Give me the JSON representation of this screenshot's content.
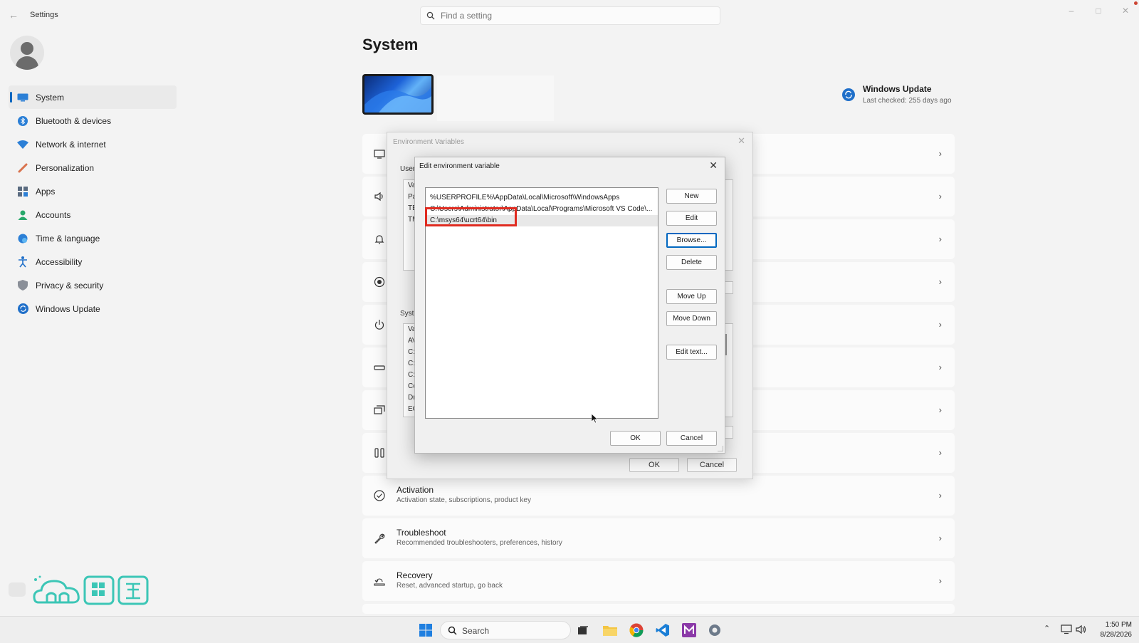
{
  "app": {
    "title": "Settings"
  },
  "search": {
    "placeholder": "Find a setting"
  },
  "sidebar": {
    "items": [
      {
        "label": "System",
        "icon": "system-icon",
        "active": true
      },
      {
        "label": "Bluetooth & devices",
        "icon": "bluetooth-icon"
      },
      {
        "label": "Network & internet",
        "icon": "wifi-icon"
      },
      {
        "label": "Personalization",
        "icon": "brush-icon"
      },
      {
        "label": "Apps",
        "icon": "apps-icon"
      },
      {
        "label": "Accounts",
        "icon": "account-icon"
      },
      {
        "label": "Time & language",
        "icon": "globe-clock-icon"
      },
      {
        "label": "Accessibility",
        "icon": "accessibility-icon"
      },
      {
        "label": "Privacy & security",
        "icon": "shield-icon"
      },
      {
        "label": "Windows Update",
        "icon": "update-icon"
      }
    ]
  },
  "main": {
    "title": "System",
    "windows_update": {
      "title": "Windows Update",
      "subtitle": "Last checked: 255 days ago"
    },
    "cards": [
      {
        "title": "Activation",
        "subtitle": "Activation state, subscriptions, product key",
        "icon": "check-circle-icon"
      },
      {
        "title": "Troubleshoot",
        "subtitle": "Recommended troubleshooters, preferences, history",
        "icon": "wrench-icon"
      },
      {
        "title": "Recovery",
        "subtitle": "Reset, advanced startup, go back",
        "icon": "recovery-icon"
      }
    ]
  },
  "env_dialog": {
    "title": "Environment Variables",
    "user_label": "User",
    "system_label": "Syste",
    "user_rows": [
      "Va",
      "Pa",
      "TE",
      "TM"
    ],
    "system_rows": [
      "Va",
      "AV",
      "C:",
      "C:",
      "C:",
      "Co",
      "Dr",
      "EC"
    ],
    "ok": "OK",
    "cancel": "Cancel"
  },
  "edit_dialog": {
    "title": "Edit environment variable",
    "paths": [
      "%USERPROFILE%\\AppData\\Local\\Microsoft\\WindowsApps",
      "C:\\Users\\Administrator\\AppData\\Local\\Programs\\Microsoft VS Code\\...",
      "C:\\msys64\\ucrt64\\bin"
    ],
    "selected_index": 2,
    "buttons": {
      "new": "New",
      "edit": "Edit",
      "browse": "Browse...",
      "delete": "Delete",
      "move_up": "Move Up",
      "move_down": "Move Down",
      "edit_text": "Edit text...",
      "ok": "OK",
      "cancel": "Cancel"
    }
  },
  "taskbar": {
    "search_label": "Search",
    "time": "1:50 PM",
    "date": "8/28/2026"
  },
  "colors": {
    "accent": "#0067c0",
    "highlight": "#e02b20"
  }
}
